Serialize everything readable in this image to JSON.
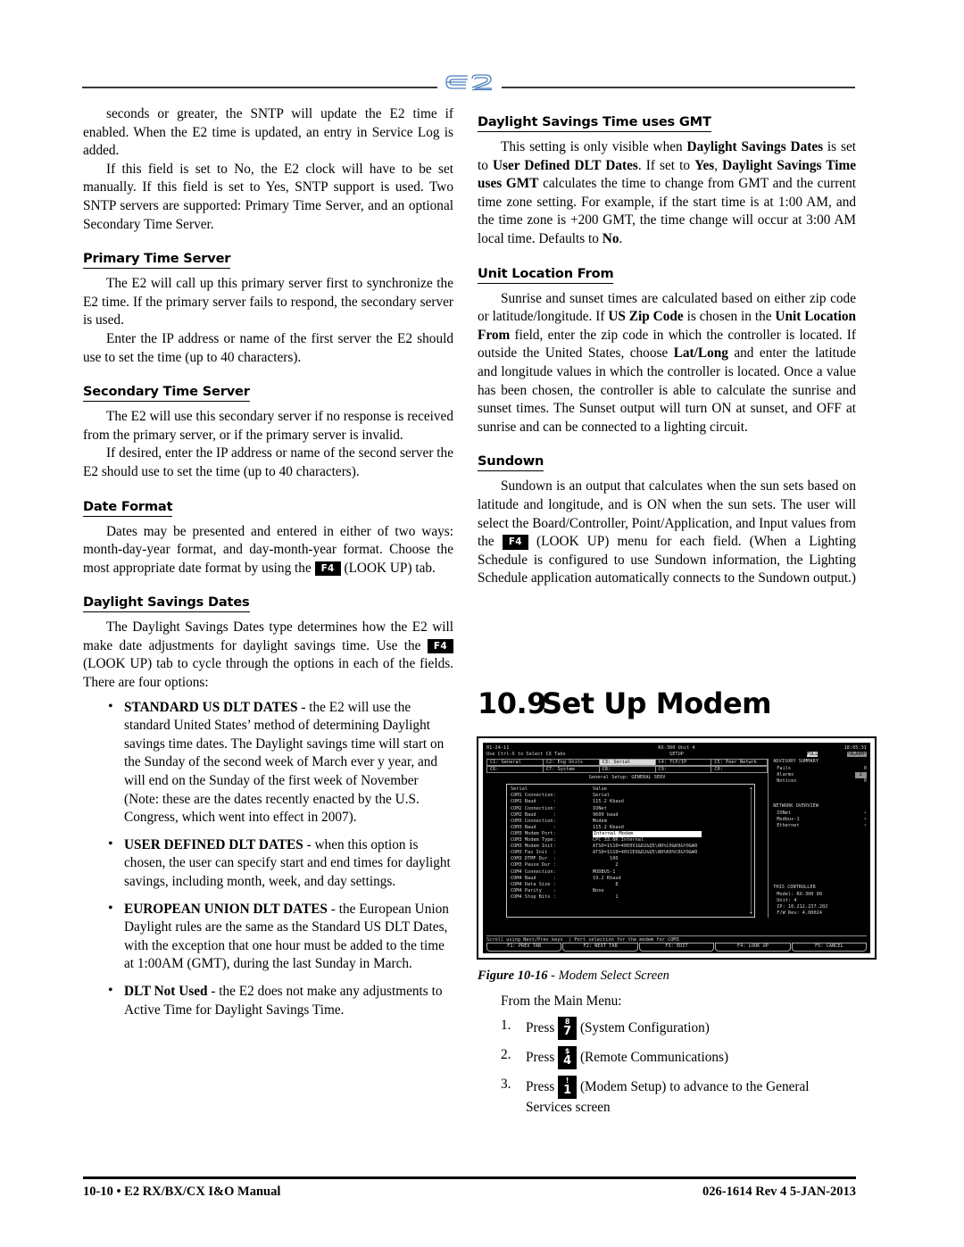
{
  "header": {
    "logo_text": "E2"
  },
  "left_column": {
    "p1": "seconds or greater, the SNTP will update the E2 time if enabled. When the E2 time is updated, an entry in Service Log is added.",
    "p2": "If this field is set to No, the E2 clock will have to be set manually. If this field is set to Yes, SNTP support is used. Two SNTP servers are supported: Primary Time Server, and an optional Secondary Time Server.",
    "h_primary": "Primary Time Server",
    "p3": "The E2 will call up this primary server first to synchronize the E2 time. If the primary server fails to respond, the secondary server is used.",
    "p4": "Enter the IP address or name of the first server the E2 should use to set the time (up to 40 characters).",
    "h_secondary": "Secondary Time Server",
    "p5": "The E2 will use this secondary server if no response is received from the primary server, or if the primary server is invalid.",
    "p6": "If desired, enter the IP address or name of the second server the E2 should use to set the time (up to 40 characters).",
    "h_dateformat": "Date Format",
    "p7a": "Dates may be presented and entered in either of two ways: month-day-year format, and day-month-year format. Choose the most appropriate date format by using the",
    "p7_key": "F4",
    "p7b": "(LOOK UP) tab.",
    "h_dst": "Daylight Savings Dates",
    "p8a": "The Daylight Savings Dates type determines how the E2 will make date adjustments for daylight savings time. Use the",
    "p8_key": "F4",
    "p8b": "(LOOK UP) tab to cycle through the options in each of the fields. There are four options:",
    "bullets": [
      {
        "term": "STANDARD US DLT DATES",
        "text": " - the E2 will use the standard United States’ method of  determining Daylight savings time dates. The Daylight savings time will start on the  Sunday of the second week of March ever y year, and will end on the Sunday of the first week of November (Note: these are the dates recently enacted by the U.S. Congress, which went into  effect in 2007)."
      },
      {
        "term": "USER DEFINED DLT DATES",
        "text": " - when this option is chosen, the user can specify start and end times for daylight savings, including month, week, and day settings."
      },
      {
        "term": "EUROPEAN UNION DLT DATES",
        "text": " - the European Union Daylight rules are the same as the Standard US DLT Dates, with the exception that one hour must be added to the time at 1:00AM (GMT), during the last Sunday in March."
      },
      {
        "term": "DLT Not Used",
        "text": " - the E2 does not make any adjustments to Active Time for Daylight Savings Time."
      }
    ]
  },
  "right_column": {
    "h_gmt": "Daylight Savings Time uses GMT",
    "p_gmt_1": "This setting is only visible when ",
    "p_gmt_b1": "Daylight Savings Dates",
    "p_gmt_2": " is set to ",
    "p_gmt_b2": "User Defined DLT Dates",
    "p_gmt_3": ". If set to ",
    "p_gmt_b3": "Yes",
    "p_gmt_4": ", ",
    "p_gmt_b4": "Daylight Savings Time uses GMT",
    "p_gmt_5": " calculates the time to change from GMT and the current time zone setting. For example, if the start time is at 1:00 AM, and the time zone is +200 GMT, the time change will occur at 3:00 AM local time. Defaults to ",
    "p_gmt_b5": "No",
    "p_gmt_6": ".",
    "h_unitloc": "Unit Location From",
    "p_loc_1": "Sunrise and sunset times are calculated based on either zip code or latitude/longitude. If ",
    "p_loc_b1": "US Zip Code",
    "p_loc_2": " is chosen in the ",
    "p_loc_b2": "Unit Location From",
    "p_loc_3": " field, enter the zip code in which the controller is located. If outside the United States, choose ",
    "p_loc_b3": "Lat/Long",
    "p_loc_4": " and enter the latitude and longitude values in which the controller is located. Once a value has been chosen, the controller is able to calculate the sunrise and sunset times. The Sunset output will turn ON at sunset, and OFF at sunrise and can be connected to a lighting circuit.",
    "h_sundown": "Sundown",
    "p_sd_a": "Sundown is an output that calculates when the sun sets based on latitude and longitude, and is ON when the sun sets. The user will select the Board/Controller, Point/Application, and Input values from the",
    "p_sd_key": "F4",
    "p_sd_b": "(LOOK UP) menu for each field. (When a Lighting Schedule is configured to use Sundown information, the Lighting Schedule application automatically connects to the Sundown output.)"
  },
  "section": {
    "number": "10.9",
    "title": "Set Up Modem"
  },
  "terminal": {
    "date": "01-24-11",
    "unit_title": "RX-300 Unit 4",
    "clock": "18:05:31",
    "hint": "Use Ctrl-X to Select CX Tabs",
    "mode": "SETUP",
    "full_badge": "FULL",
    "alarm_badge": "*ALARM*",
    "tabs_row1": [
      "C1: General",
      "C2: Eng Units",
      "C3: Serial",
      "C4: TCP/IP",
      "C5: Peer Netwrk"
    ],
    "tabs_row2": [
      "C6:",
      "C7: System",
      "C8:",
      "C9:",
      "C0:"
    ],
    "selected_tab": "C3: Serial",
    "subheader": "General Setup: GENERAL SERV",
    "list_header": {
      "name": "Serial",
      "value": "Value"
    },
    "rows": [
      {
        "label": "COM1 Connection:",
        "value": "Serial"
      },
      {
        "label": "COM1 Baud      :",
        "value": "115.2 Kbaud"
      },
      {
        "label": "COM2 Connection:",
        "value": "IONet"
      },
      {
        "label": "COM2 Baud      :",
        "value": "9600 baud"
      },
      {
        "label": "COM3 Connection:",
        "value": "Modem"
      },
      {
        "label": "COM3 Baud      :",
        "value": "115.2 Kbaud"
      },
      {
        "label": "COM3 Modem Port:",
        "value": "Internal Modem",
        "highlight": true
      },
      {
        "label": "COM3 Modem Type:",
        "value": "CPC 33.6K Internal"
      },
      {
        "label": "COM3 Modem Init:",
        "value": "ATS0=1S10=40E0V1&D2&Q5\\N0%C0&K0&Y0&W0"
      },
      {
        "label": "COM3 Fax Init  :",
        "value": "ATS0=1S10=40V1E0&D2&Q5\\N0%K0%C0&Y0&W0"
      },
      {
        "label": "COM3 DTMF Dur  :",
        "value": "      100"
      },
      {
        "label": "COM3 Pause Dur :",
        "value": "        2"
      },
      {
        "label": "COM4 Connection:",
        "value": "MODBUS-1"
      },
      {
        "label": "COM4 Baud      :",
        "value": "19.2 Kbaud"
      },
      {
        "label": "COM4 Data Size :",
        "value": "        8"
      },
      {
        "label": "COM4 Parity    :",
        "value": "None"
      },
      {
        "label": "COM4 Stop Bits :",
        "value": "        1"
      }
    ],
    "advisory": {
      "title": "ADVISORY SUMMARY",
      "items": [
        {
          "label": "Fails",
          "value": "0"
        },
        {
          "label": "Alarms",
          "value": "2",
          "highlight": true
        },
        {
          "label": "Notices",
          "value": "0"
        }
      ]
    },
    "network": {
      "title": "NETWORK OVERVIEW",
      "items": [
        {
          "label": "IONet",
          "value": "•"
        },
        {
          "label": "Modbus-1",
          "value": "•"
        },
        {
          "label": "Ethernet",
          "value": "•"
        }
      ]
    },
    "controller": {
      "title": "THIS CONTROLLER",
      "lines": [
        "Model: RX-300  00",
        "Unit: 4",
        "IP: 10.212.237.202",
        "F/W Rev: 4.00024"
      ]
    },
    "status_line": "Scroll using Next/Prev keys  | Port selection for the modem for COM3",
    "fkeys": [
      "F1: PREV TAB",
      "F2: NEXT TAB",
      "F3: EDIT",
      "F4: LOOK UP",
      "F5: CANCEL"
    ]
  },
  "figure": {
    "label": "Figure 10-16",
    "dash": " - ",
    "caption": "Modem Select Screen"
  },
  "steps": {
    "lead": "From the Main Menu:",
    "items": [
      {
        "num": "1.",
        "press": "Press",
        "key_shift": "8",
        "key_main": "7",
        "desc": "(System Configuration)"
      },
      {
        "num": "2.",
        "press": "Press",
        "key_shift": "$",
        "key_main": "4",
        "desc": "(Remote Communications)"
      },
      {
        "num": "3.",
        "press": "Press",
        "key_shift": "!",
        "key_main": "1",
        "desc": "(Modem Setup) to advance to the General Services screen"
      }
    ]
  },
  "footer": {
    "left": "10-10 • E2 RX/BX/CX I&O Manual",
    "right": "026-1614 Rev 4 5-JAN-2013"
  }
}
